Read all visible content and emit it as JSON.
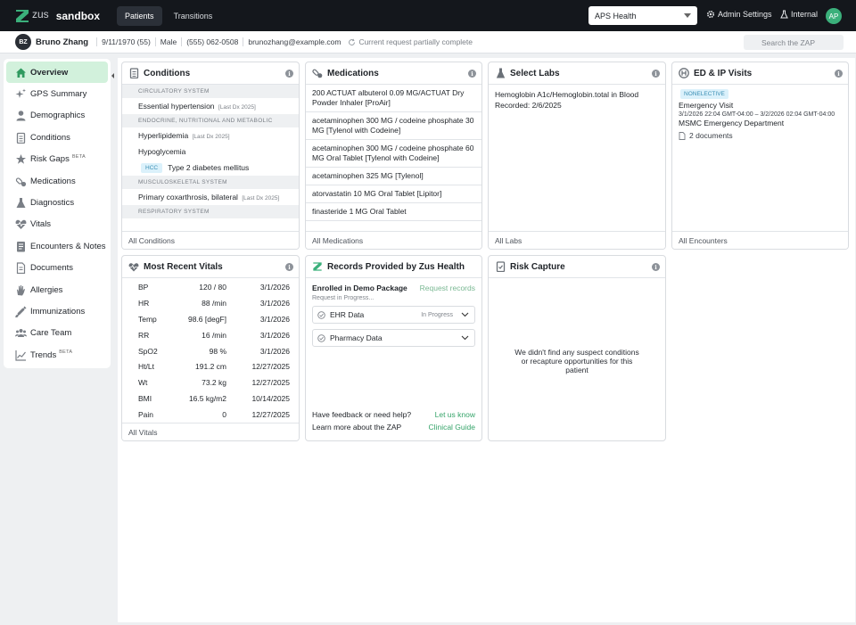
{
  "topbar": {
    "logo_text": "zus",
    "brand": "sandbox",
    "tabs": [
      {
        "label": "Patients"
      },
      {
        "label": "Transitions"
      }
    ],
    "org_select": "APS Health",
    "admin_settings": "Admin Settings",
    "internal": "Internal",
    "user_initials": "AP"
  },
  "patient": {
    "initials": "BZ",
    "name": "Bruno Zhang",
    "dob_age": "9/11/1970 (55)",
    "sex": "Male",
    "phone": "(555) 062-0508",
    "email": "brunozhang@example.com",
    "status": "Current request partially complete",
    "search_placeholder": "Search the ZAP"
  },
  "sidebar": {
    "items": [
      {
        "label": "Overview",
        "icon": "home-icon",
        "beta": ""
      },
      {
        "label": "GPS Summary",
        "icon": "sparkle-icon",
        "beta": ""
      },
      {
        "label": "Demographics",
        "icon": "person-icon",
        "beta": ""
      },
      {
        "label": "Conditions",
        "icon": "clipboard-icon",
        "beta": ""
      },
      {
        "label": "Risk Gaps",
        "icon": "star-icon",
        "beta": "BETA"
      },
      {
        "label": "Medications",
        "icon": "pill-icon",
        "beta": ""
      },
      {
        "label": "Diagnostics",
        "icon": "flask-icon",
        "beta": ""
      },
      {
        "label": "Vitals",
        "icon": "heart-icon",
        "beta": ""
      },
      {
        "label": "Encounters & Notes",
        "icon": "notes-icon",
        "beta": ""
      },
      {
        "label": "Documents",
        "icon": "document-icon",
        "beta": ""
      },
      {
        "label": "Allergies",
        "icon": "hand-icon",
        "beta": ""
      },
      {
        "label": "Immunizations",
        "icon": "syringe-icon",
        "beta": ""
      },
      {
        "label": "Care Team",
        "icon": "people-icon",
        "beta": ""
      },
      {
        "label": "Trends",
        "icon": "trend-icon",
        "beta": "BETA"
      }
    ]
  },
  "conditions": {
    "title": "Conditions",
    "footer": "All Conditions",
    "sec1": "CIRCULATORY SYSTEM",
    "r1": "Essential hypertension",
    "r1_tag": "[Last Dx 2025]",
    "sec2": "ENDOCRINE, NUTRITIONAL AND METABOLIC",
    "r2": "Hyperlipidemia",
    "r2_tag": "[Last Dx 2025]",
    "r3": "Hypoglycemia",
    "r4_badge": "HCC",
    "r4": "Type 2 diabetes mellitus",
    "sec3": "MUSCULOSKELETAL SYSTEM",
    "r5": "Primary coxarthrosis, bilateral",
    "r5_tag": "[Last Dx 2025]",
    "sec4": "RESPIRATORY SYSTEM"
  },
  "medications": {
    "title": "Medications",
    "footer": "All Medications",
    "items": [
      "200 ACTUAT albuterol 0.09 MG/ACTUAT Dry Powder Inhaler [ProAir]",
      "acetaminophen 300 MG / codeine phosphate 30 MG [Tylenol with Codeine]",
      "acetaminophen 300 MG / codeine phosphate 60 MG Oral Tablet [Tylenol with Codeine]",
      "acetaminophen 325 MG [Tylenol]",
      "atorvastatin 10 MG Oral Tablet [Lipitor]",
      "finasteride 1 MG Oral Tablet"
    ]
  },
  "labs": {
    "title": "Select Labs",
    "footer": "All Labs",
    "name": "Hemoglobin A1c/Hemoglobin.total in Blood",
    "recorded": "Recorded: 2/6/2025"
  },
  "encounters": {
    "title": "ED & IP Visits",
    "footer": "All Encounters",
    "badge": "NONELECTIVE",
    "type": "Emergency Visit",
    "dates": "3/1/2026 22:04 GMT-04:00 – 3/2/2026 02:04 GMT-04:00",
    "facility": "MSMC Emergency Department",
    "docs": "2 documents"
  },
  "vitals": {
    "title": "Most Recent Vitals",
    "footer": "All Vitals",
    "rows": [
      {
        "name": "BP",
        "value": "120 / 80",
        "date": "3/1/2026"
      },
      {
        "name": "HR",
        "value": "88 /min",
        "date": "3/1/2026"
      },
      {
        "name": "Temp",
        "value": "98.6 [degF]",
        "date": "3/1/2026"
      },
      {
        "name": "RR",
        "value": "16 /min",
        "date": "3/1/2026"
      },
      {
        "name": "SpO2",
        "value": "98 %",
        "date": "3/1/2026"
      },
      {
        "name": "Ht/Lt",
        "value": "191.2 cm",
        "date": "12/27/2025"
      },
      {
        "name": "Wt",
        "value": "73.2 kg",
        "date": "12/27/2025"
      },
      {
        "name": "BMI",
        "value": "16.5 kg/m2",
        "date": "10/14/2025"
      },
      {
        "name": "Pain",
        "value": "0",
        "date": "12/27/2025"
      }
    ]
  },
  "records": {
    "title": "Records Provided by Zus Health",
    "enrolled": "Enrolled in Demo Package",
    "request_link": "Request records",
    "request_status": "Request in Progress...",
    "ehr": "EHR Data",
    "ehr_status": "In Progress",
    "pharmacy": "Pharmacy Data",
    "feedback": "Have feedback or need help?",
    "feedback_link": "Let us know",
    "learn": "Learn more about the ZAP",
    "learn_link": "Clinical Guide"
  },
  "risk": {
    "title": "Risk Capture",
    "empty": "We didn't find any suspect conditions or recapture opportunities for this patient"
  },
  "colors": {
    "accent": "#36a46a",
    "active_nav": "#d2f1dc",
    "topbar": "#14171c"
  }
}
